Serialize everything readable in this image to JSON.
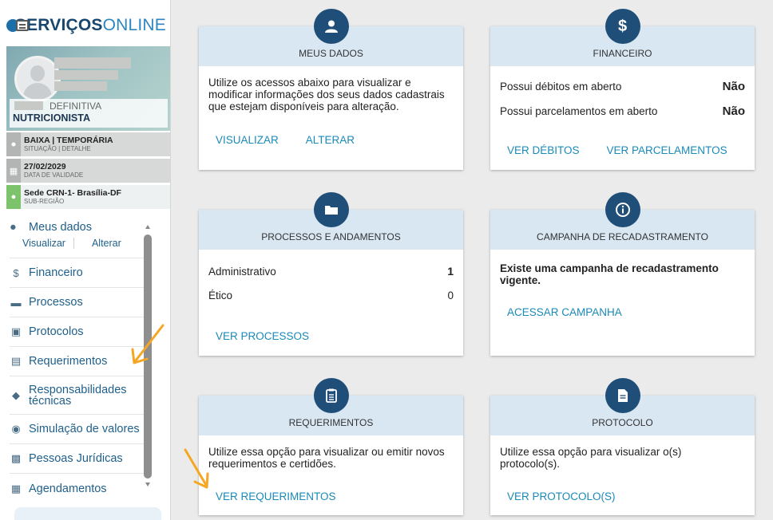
{
  "brand": {
    "part1": "SERVIÇOS",
    "part2": "ONLINE"
  },
  "profile": {
    "registration_type": "DEFINITIVA",
    "profession": "NUTRICIONISTA"
  },
  "info": [
    {
      "main": "BAIXA | TEMPORÁRIA",
      "sub": "SITUAÇÃO | DETALHE",
      "icon": "lock-icon"
    },
    {
      "main": "27/02/2029",
      "sub": "DATA DE VALIDADE",
      "icon": "calendar-icon"
    },
    {
      "main": "Sede CRN-1- Brasília-DF",
      "sub": "SUB-REGIÃO",
      "icon": "map-pin-icon"
    }
  ],
  "menu": {
    "meus_dados": "Meus dados",
    "visualizar": "Visualizar",
    "alterar": "Alterar",
    "items": [
      {
        "label": "Financeiro"
      },
      {
        "label": "Processos"
      },
      {
        "label": "Protocolos"
      },
      {
        "label": "Requerimentos"
      },
      {
        "label": "Responsabilidades técnicas"
      },
      {
        "label": "Simulação de valores"
      },
      {
        "label": "Pessoas Jurídicas"
      },
      {
        "label": "Agendamentos"
      }
    ]
  },
  "cards": {
    "meus_dados": {
      "title": "MEUS DADOS",
      "text": "Utilize os acessos abaixo para visualizar e modificar informações dos seus dados cadastrais que estejam disponíveis para alteração.",
      "link1": "VISUALIZAR",
      "link2": "ALTERAR"
    },
    "financeiro": {
      "title": "FINANCEIRO",
      "row1_label": "Possui débitos em aberto",
      "row1_value": "Não",
      "row2_label": "Possui parcelamentos em aberto",
      "row2_value": "Não",
      "link1": "VER DÉBITOS",
      "link2": "VER PARCELAMENTOS"
    },
    "processos": {
      "title": "PROCESSOS E ANDAMENTOS",
      "row1_label": "Administrativo",
      "row1_value": "1",
      "row2_label": "Ético",
      "row2_value": "0",
      "link": "VER PROCESSOS"
    },
    "campanha": {
      "title": "CAMPANHA DE RECADASTRAMENTO",
      "text": "Existe uma campanha de recadastramento vigente.",
      "link": "ACESSAR CAMPANHA"
    },
    "requerimentos": {
      "title": "REQUERIMENTOS",
      "text": "Utilize essa opção para visualizar ou emitir novos requerimentos e certidões.",
      "link": "VER REQUERIMENTOS"
    },
    "protocolo": {
      "title": "PROTOCOLO",
      "text": "Utilize essa opção para visualizar o(s) protocolo(s).",
      "link": "VER PROTOCOLO(S)"
    }
  },
  "colors": {
    "accent_dark": "#1f4e78",
    "link": "#1a8ab8",
    "card_header": "#d9e7f3",
    "annotation_arrow": "#f5a623"
  }
}
